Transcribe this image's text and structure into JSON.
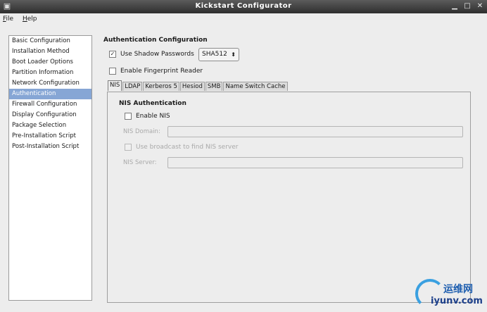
{
  "window": {
    "title": "Kickstart Configurator"
  },
  "menu": [
    "File",
    "Help"
  ],
  "sidebar": {
    "items": [
      "Basic Configuration",
      "Installation Method",
      "Boot Loader Options",
      "Partition Information",
      "Network Configuration",
      "Authentication",
      "Firewall Configuration",
      "Display Configuration",
      "Package Selection",
      "Pre-Installation Script",
      "Post-Installation Script"
    ],
    "selected": "Authentication"
  },
  "auth": {
    "section_title": "Authentication Configuration",
    "shadow_label": "Use Shadow Passwords",
    "shadow_checked": true,
    "hash_value": "SHA512",
    "fingerprint_label": "Enable Fingerprint Reader",
    "fingerprint_checked": false
  },
  "tabs": [
    "NIS",
    "LDAP",
    "Kerberos 5",
    "Hesiod",
    "SMB",
    "Name Switch Cache"
  ],
  "active_tab": "NIS",
  "nis": {
    "title": "NIS Authentication",
    "enable_label": "Enable NIS",
    "domain_label": "NIS Domain:",
    "domain_value": "",
    "broadcast_label": "Use broadcast to find NIS server",
    "server_label": "NIS Server:",
    "server_value": ""
  },
  "watermark": {
    "text": "运维网",
    "url": "iyunv.com"
  }
}
